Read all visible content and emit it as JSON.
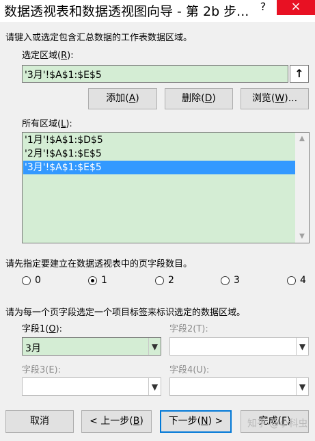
{
  "window": {
    "title": "数据透视表和数据透视图向导 - 第 2b 步...",
    "help_label": "?",
    "close_label": "×"
  },
  "range_section": {
    "instruction": "请键入或选定包含汇总数据的工作表数据区域。",
    "select_label_prefix": "选定区域(",
    "select_label_key": "R",
    "select_label_suffix": "):",
    "range_value": "'3月'!$A$1:$E$5",
    "collapse_icon": "↑"
  },
  "buttons": {
    "add": {
      "prefix": "添加(",
      "key": "A",
      "suffix": ")"
    },
    "delete": {
      "prefix": "删除(",
      "key": "D",
      "suffix": ")"
    },
    "browse": {
      "prefix": "浏览(",
      "key": "W",
      "suffix": ")..."
    }
  },
  "all_ranges": {
    "label_prefix": "所有区域(",
    "label_key": "L",
    "label_suffix": "):",
    "items": [
      "'1月'!$A$1:$D$5",
      "'2月'!$A$1:$E$5",
      "'3月'!$A$1:$E$5"
    ],
    "selected_index": 2
  },
  "page_fields": {
    "instruction": "请先指定要建立在数据透视表中的页字段数目。",
    "options": [
      "0",
      "1",
      "2",
      "3",
      "4"
    ],
    "selected": "1"
  },
  "field_labels": {
    "instruction": "请为每一个页字段选定一个项目标签来标识选定的数据区域。",
    "field1": {
      "prefix": "字段1(",
      "key": "O",
      "suffix": "):",
      "value": "3月"
    },
    "field2": {
      "label": "字段2(T):",
      "value": ""
    },
    "field3": {
      "label": "字段3(E):",
      "value": ""
    },
    "field4": {
      "label": "字段4(U):",
      "value": ""
    }
  },
  "footer": {
    "cancel": "取消",
    "back": {
      "prefix": "< 上一步(",
      "key": "B",
      "suffix": ")"
    },
    "next": {
      "prefix": "下一步(",
      "key": "N",
      "suffix": ") >"
    },
    "finish": {
      "prefix": "完成(",
      "key": "F",
      "suffix": ")"
    },
    "watermark": "知乎 @小科虫"
  },
  "colors": {
    "input_green": "#d4edd4",
    "selection_blue": "#3399ff",
    "close_red": "#e81123"
  }
}
